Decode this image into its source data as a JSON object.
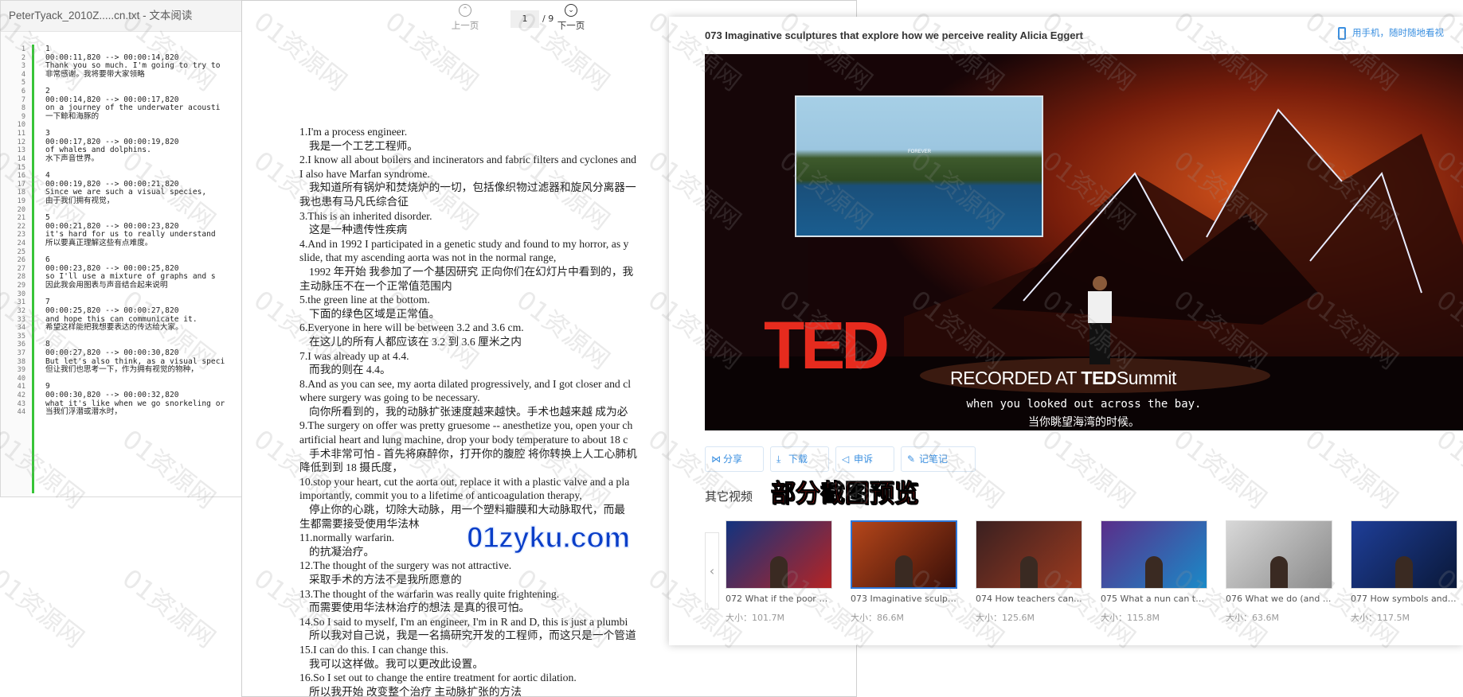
{
  "reader": {
    "title": "PeterTyack_2010Z.....cn.txt - 文本阅读",
    "lines": [
      {
        "n": "1",
        "t": "1"
      },
      {
        "n": "2",
        "t": "00:00:11,820 --> 00:00:14,820"
      },
      {
        "n": "3",
        "t": "Thank you so much. I'm going to try to"
      },
      {
        "n": "4",
        "t": "非常感谢。我将要带大家领略"
      },
      {
        "n": "5",
        "t": ""
      },
      {
        "n": "6",
        "t": "2"
      },
      {
        "n": "7",
        "t": "00:00:14,820 --> 00:00:17,820"
      },
      {
        "n": "8",
        "t": "on a journey of the underwater acousti"
      },
      {
        "n": "9",
        "t": "一下鲸和海豚的"
      },
      {
        "n": "10",
        "t": ""
      },
      {
        "n": "11",
        "t": "3"
      },
      {
        "n": "12",
        "t": "00:00:17,820 --> 00:00:19,820"
      },
      {
        "n": "13",
        "t": "of whales and dolphins."
      },
      {
        "n": "14",
        "t": "水下声音世界。"
      },
      {
        "n": "15",
        "t": ""
      },
      {
        "n": "16",
        "t": "4"
      },
      {
        "n": "17",
        "t": "00:00:19,820 --> 00:00:21,820"
      },
      {
        "n": "18",
        "t": "Since we are such a visual species,"
      },
      {
        "n": "19",
        "t": "由于我们拥有视觉，"
      },
      {
        "n": "20",
        "t": ""
      },
      {
        "n": "21",
        "t": "5"
      },
      {
        "n": "22",
        "t": "00:00:21,820 --> 00:00:23,820"
      },
      {
        "n": "23",
        "t": "it's hard for us to really understand"
      },
      {
        "n": "24",
        "t": "所以要真正理解这些有点难度。"
      },
      {
        "n": "25",
        "t": ""
      },
      {
        "n": "26",
        "t": "6"
      },
      {
        "n": "27",
        "t": "00:00:23,820 --> 00:00:25,820"
      },
      {
        "n": "28",
        "t": "so I'll use a mixture of graphs and s"
      },
      {
        "n": "29",
        "t": "因此我会用图表与声音结合起来说明"
      },
      {
        "n": "30",
        "t": ""
      },
      {
        "n": "31",
        "t": "7"
      },
      {
        "n": "32",
        "t": "00:00:25,820 --> 00:00:27,820"
      },
      {
        "n": "33",
        "t": "and hope this can communicate it."
      },
      {
        "n": "34",
        "t": "希望这样能把我想要表达的传达给大家。"
      },
      {
        "n": "35",
        "t": ""
      },
      {
        "n": "36",
        "t": "8"
      },
      {
        "n": "37",
        "t": "00:00:27,820 --> 00:00:30,820"
      },
      {
        "n": "38",
        "t": "But let's also think, as a visual speci"
      },
      {
        "n": "39",
        "t": "但让我们也思考一下，作为拥有视觉的物种，"
      },
      {
        "n": "40",
        "t": ""
      },
      {
        "n": "41",
        "t": "9"
      },
      {
        "n": "42",
        "t": "00:00:30,820 --> 00:00:32,820"
      },
      {
        "n": "43",
        "t": "what it's like when we go snorkeling or"
      },
      {
        "n": "44",
        "t": "当我们浮潜或潜水时，"
      }
    ]
  },
  "doc": {
    "prev_label": "上一页",
    "next_label": "下一页",
    "page_current": "1",
    "page_total": "/ 9",
    "lines": [
      {
        "t": "1.I'm a process engineer.",
        "i": false
      },
      {
        "t": "我是一个工艺工程师。",
        "i": true
      },
      {
        "t": "2.I know all about boilers and incinerators and fabric filters and cyclones and",
        "i": false
      },
      {
        "t": "I also have Marfan syndrome.",
        "i": false
      },
      {
        "t": "我知道所有锅炉和焚烧炉的一切，包括像织物过滤器和旋风分离器一",
        "i": true
      },
      {
        "t": "我也患有马凡氏综合征",
        "i": false
      },
      {
        "t": "3.This is an inherited disorder.",
        "i": false
      },
      {
        "t": "这是一种遗传性疾病",
        "i": true
      },
      {
        "t": "4.And in 1992 I participated in a genetic study and found to my horror, as y",
        "i": false
      },
      {
        "t": "slide, that my ascending aorta was not in the normal range,",
        "i": false
      },
      {
        "t": "1992 年开始 我参加了一个基因研究 正向你们在幻灯片中看到的，我",
        "i": true
      },
      {
        "t": "主动脉压不在一个正常值范围内",
        "i": false
      },
      {
        "t": "5.the green line at the bottom.",
        "i": false
      },
      {
        "t": "下面的绿色区域是正常值。",
        "i": true
      },
      {
        "t": "6.Everyone in here will be between 3.2 and 3.6 cm.",
        "i": false
      },
      {
        "t": "在这儿的所有人都应该在 3.2 到 3.6 厘米之内",
        "i": true
      },
      {
        "t": "7.I was already up at 4.4.",
        "i": false
      },
      {
        "t": "而我的则在 4.4。",
        "i": true
      },
      {
        "t": "8.And as you can see, my aorta dilated progressively, and I got closer and cl",
        "i": false
      },
      {
        "t": "where surgery was going to be necessary.",
        "i": false
      },
      {
        "t": "向你所看到的，我的动脉扩张速度越来越快。手术也越来越 成为必",
        "i": true
      },
      {
        "t": "9.The surgery on offer was pretty gruesome -- anesthetize you, open your ch",
        "i": false
      },
      {
        "t": "artificial heart and lung machine, drop your body temperature to about 18 c",
        "i": false
      },
      {
        "t": "手术非常可怕 - 首先将麻醉你，打开你的腹腔 将你转换上人工心肺机",
        "i": true
      },
      {
        "t": "降低到到 18 摄氏度，",
        "i": false
      },
      {
        "t": "10.stop your heart, cut the aorta out, replace it with a plastic valve and a pla",
        "i": false
      },
      {
        "t": "importantly, commit you to a lifetime of anticoagulation therapy,",
        "i": false
      },
      {
        "t": "停止你的心跳，切除大动脉，用一个塑料瓣膜和大动脉取代，而最",
        "i": true
      },
      {
        "t": "生都需要接受使用华法林",
        "i": false
      },
      {
        "t": "11.normally warfarin.",
        "i": false
      },
      {
        "t": "的抗凝治疗。",
        "i": true
      },
      {
        "t": "12.The thought of the surgery was not attractive.",
        "i": false
      },
      {
        "t": "采取手术的方法不是我所愿意的",
        "i": true
      },
      {
        "t": "13.The thought of the warfarin was really quite frightening.",
        "i": false
      },
      {
        "t": "而需要使用华法林治疗的想法 是真的很可怕。",
        "i": true
      },
      {
        "t": "14.So I said to myself, I'm an engineer, I'm in R and D, this is just a plumbi",
        "i": false
      },
      {
        "t": "所以我对自己说，我是一名搞研究开发的工程师，而这只是一个管道",
        "i": true
      },
      {
        "t": "15.I can do this. I can change this.",
        "i": false
      },
      {
        "t": "我可以这样做。我可以更改此设置。",
        "i": true
      },
      {
        "t": "16.So I set out to change the entire treatment for aortic dilation.",
        "i": false
      },
      {
        "t": "所以我开始 改变整个治疗 主动脉扩张的方法",
        "i": true
      }
    ]
  },
  "player": {
    "title": "073 Imaginative sculptures that explore how we perceive reality Alicia Eggert",
    "phone_link": "用手机，随时随地看视",
    "video": {
      "slide_caption": "FOREVER",
      "ted_logo": "TED",
      "recorded_prefix": "RECORDED AT ",
      "recorded_brand": "TED",
      "recorded_suffix": "Summit",
      "subtitle_en": "when you looked out across the bay.",
      "subtitle_cn": "当你眺望海湾的时候。"
    },
    "actions": [
      {
        "name": "share-button",
        "icon": "⋈",
        "label": "分享",
        "icon_name": "share-icon"
      },
      {
        "name": "download-button",
        "icon": "⤓",
        "label": "下载",
        "icon_name": "download-icon"
      },
      {
        "name": "complaint-button",
        "icon": "◁",
        "label": "申诉",
        "icon_name": "megaphone-icon"
      },
      {
        "name": "notes-button",
        "icon": "✎",
        "label": "记笔记",
        "icon_name": "pencil-icon"
      }
    ],
    "others_title": "其它视频",
    "preview_stamp": "部分截图预览",
    "thumbs": [
      {
        "name": "072 What if the poor w...",
        "size": "大小：101.7M",
        "active": false
      },
      {
        "name": "073 Imaginative sculpt...",
        "size": "大小：86.6M",
        "active": true
      },
      {
        "name": "074 How teachers can...",
        "size": "大小：125.6M",
        "active": false
      },
      {
        "name": "075 What a nun can te...",
        "size": "大小：115.8M",
        "active": false
      },
      {
        "name": "076 What we do (and ...",
        "size": "大小：63.6M",
        "active": false
      },
      {
        "name": "077 How symbols and ...",
        "size": "大小：117.5M",
        "active": false
      }
    ]
  },
  "site_mark": "01zyku.com",
  "watermark": "01资源网",
  "colors": {
    "accent": "#3a8fe0",
    "ted_red": "#e62b1e",
    "gutter_green": "#38c438",
    "stamp_red": "#e41e18",
    "site_blue": "#0a3ec8"
  }
}
